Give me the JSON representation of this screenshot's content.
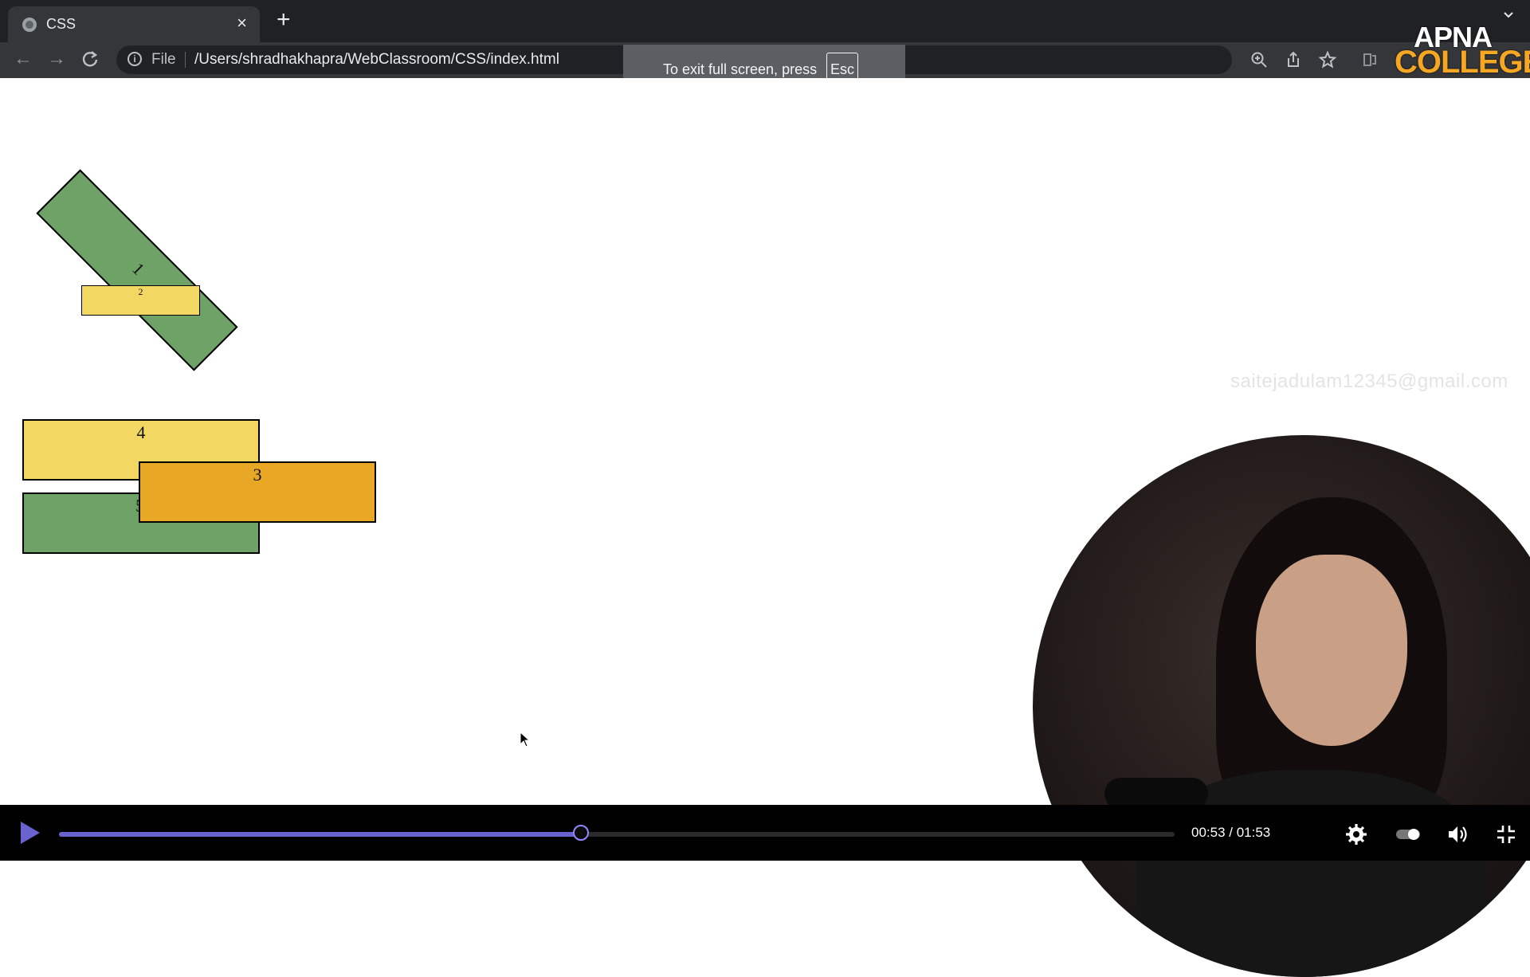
{
  "browser": {
    "tab_title": "CSS",
    "tab_close": "×",
    "new_tab": "+",
    "address": {
      "scheme_label": "File",
      "url": "/Users/shradhakhapra/WebClassroom/CSS/index.html"
    }
  },
  "fullscreen_toast": {
    "message": "To exit full screen, press",
    "key": "Esc"
  },
  "brand_logo": {
    "line1": "APNA",
    "line2": "COLLEGE"
  },
  "page": {
    "boxes": {
      "rotated_label": "1",
      "small_label": "2",
      "box3_label": "3",
      "box4_label": "4",
      "box5_label": "5"
    },
    "colors": {
      "green": "#6fa266",
      "yellow": "#f2d862",
      "orange": "#e8a725"
    },
    "watermark": "saitejadulam12345@gmail.com"
  },
  "player": {
    "current_time": "00:53",
    "duration": "01:53",
    "time_display": "00:53 / 01:53",
    "progress": 0.468,
    "accent_color": "#6a63cf"
  }
}
